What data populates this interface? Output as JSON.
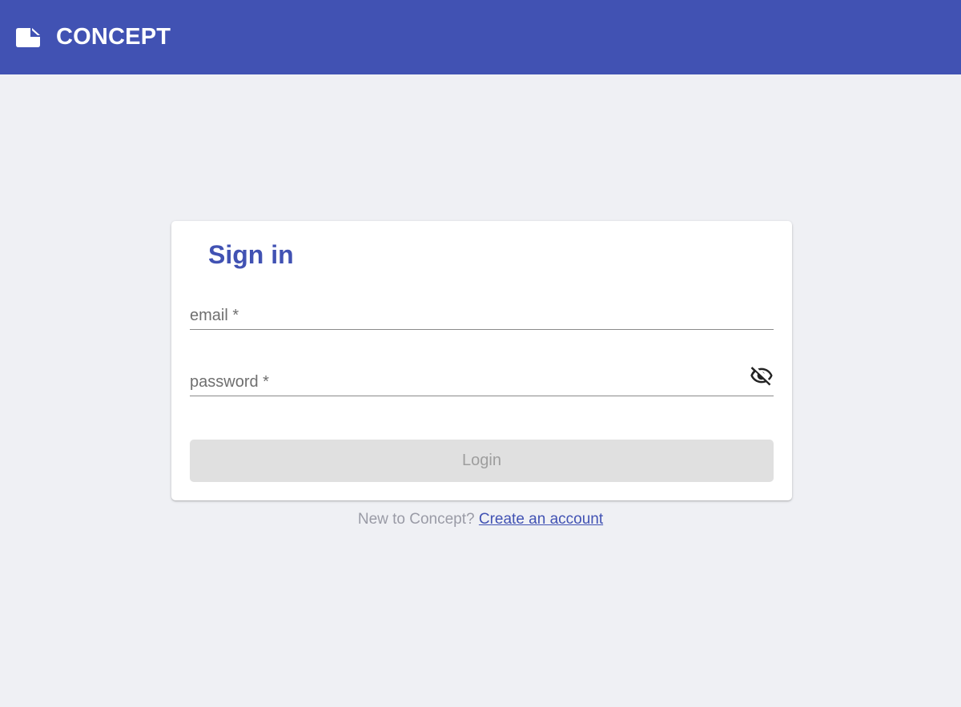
{
  "app": {
    "title": "CONCEPT",
    "brand_color": "#4152b3",
    "logo_icon": "label-icon"
  },
  "signin": {
    "title": "Sign in",
    "email_placeholder": "email *",
    "email_value": "",
    "password_placeholder": "password *",
    "password_value": "",
    "visibility_icon": "eye-off-icon",
    "login_label": "Login"
  },
  "footer": {
    "prompt": "New to Concept?",
    "link_label": "Create an account"
  }
}
